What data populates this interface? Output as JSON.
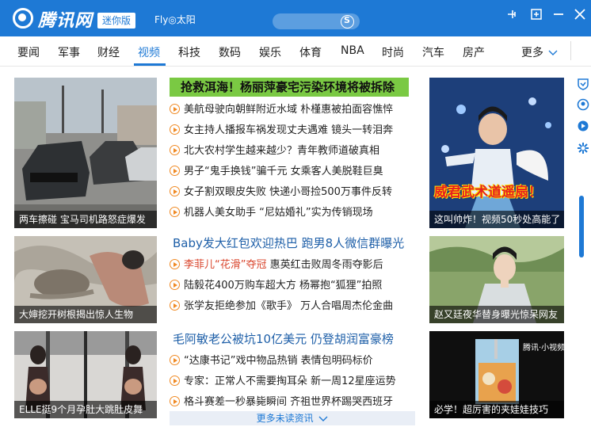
{
  "titlebar": {
    "logo_text": "腾讯网",
    "mini_label": "迷你版",
    "weather_text": "Fly◎太阳",
    "search_placeholder": ""
  },
  "nav": {
    "items": [
      "要闻",
      "军事",
      "财经",
      "视频",
      "科技",
      "数码",
      "娱乐",
      "体育",
      "NBA",
      "时尚",
      "汽车",
      "房产"
    ],
    "active": "视频",
    "more_label": "更多"
  },
  "cards": {
    "left_1": "两车擦碰 宝马司机路怒症爆发",
    "left_2": "大婶挖开树根揭出惊人生物",
    "left_3": "ELLE挺9个月孕肚大跳肚皮舞",
    "right_1": "这叫帅炸！视频50秒处高能了",
    "right_1_overlay": "威君武术道遥扇！",
    "right_2": "赵又廷夜华替身曝光惊呆网友",
    "right_3": "必学！超厉害的夹娃娃技巧",
    "right_3_overlay": "腾讯·小视频"
  },
  "sections": [
    {
      "headline": "抢救洱海！杨丽萍豪宅污染环境将被拆除",
      "items": [
        "美航母驶向朝鲜附近水域 朴槿惠被拍面容憔悴",
        "女主持人播报车祸发现丈夫遇难 镜头一转泪奔",
        "北大农村学生越来越少？青年教师道破真相",
        "男子“鬼手换钱”骗千元 女乘客人美脱鞋巨臭",
        "女子割双眼皮失败 快递小哥捡500万事件反转",
        "机器人美女助手 “尼姑婚礼”实为传销现场"
      ]
    },
    {
      "headline": "Baby发大红包欢迎热巴 跑男8人微信群曝光",
      "items": [
        "李菲儿“花滑”夺冠 惠英红击败周冬雨夺影后",
        "陆毅花400万购车超大方 杨幂抱“狐狸”拍照",
        "张学友拒绝参加《歌手》 万人合唱周杰伦金曲"
      ],
      "highlight": "李菲儿“花滑”夺冠"
    },
    {
      "headline": "毛阿敏老公被坑10亿美元 仍登胡润富豪榜",
      "items": [
        "“达康书记”戏中物品热销 表情包明码标价",
        "专家：正常人不需要掏耳朵 新一周12星座运势",
        "格斗赛差一秒暴毙瞬间 齐祖世界杯踢哭西班牙"
      ]
    }
  ],
  "more_unread": "更多未读资讯",
  "colors": {
    "brand_blue": "#1e79d5",
    "headline_green": "#7ac943",
    "play_orange": "#f08a24",
    "highlight_red": "#d9442b"
  },
  "icons": [
    "pin-icon",
    "maximize-icon",
    "minimize-icon",
    "close-icon",
    "search-icon",
    "play-circle-icon",
    "chevron-down-icon",
    "shield-icon",
    "user-icon",
    "video-icon",
    "settings-icon"
  ]
}
